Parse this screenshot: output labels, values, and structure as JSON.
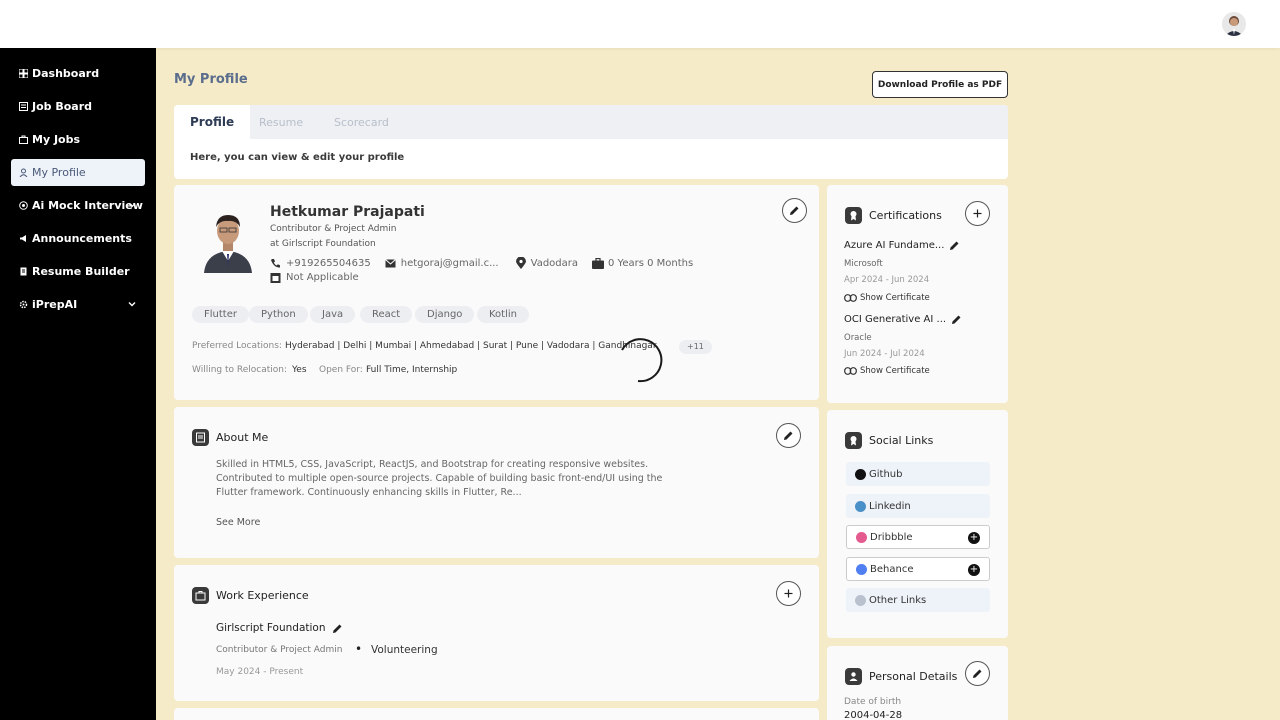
{
  "sidebar": {
    "items": [
      {
        "label": "Dashboard",
        "icon": "grid-icon"
      },
      {
        "label": "Job Board",
        "icon": "board-icon"
      },
      {
        "label": "My Jobs",
        "icon": "bag-icon"
      },
      {
        "label": "My Profile",
        "icon": "user-icon",
        "active": true
      },
      {
        "label": "Ai Mock Interview",
        "icon": "ai-icon",
        "expandable": true
      },
      {
        "label": "Announcements",
        "icon": "megaphone-icon"
      },
      {
        "label": "Resume Builder",
        "icon": "document-icon"
      },
      {
        "label": "iPrepAI",
        "icon": "gear-icon",
        "expandable": true
      }
    ]
  },
  "page": {
    "title": "My Profile",
    "download_pdf": "Download Profile as PDF"
  },
  "tabs": {
    "items": [
      "Profile",
      "Resume",
      "Scorecard"
    ],
    "active": "Profile",
    "description": "Here, you can view & edit your profile"
  },
  "profile": {
    "name": "Hetkumar Prajapati",
    "role": "Contributor & Project Admin",
    "organization": "at Girlscript Foundation",
    "phone": "+919265504635",
    "email": "hetgoraj@gmail.c...",
    "location": "Vadodara",
    "experience": "0 Years 0 Months",
    "notice": "Not Applicable",
    "skills": [
      "Flutter",
      "Python",
      "Java",
      "React",
      "Django",
      "Kotlin"
    ],
    "preferred_locations_label": "Preferred Locations:",
    "preferred_locations": "Hyderabad | Delhi | Mumbai | Ahmedabad | Surat | Pune | Vadodara | Gandhinagar",
    "more_locations": "+11",
    "relocation_label": "Willing to Relocation:",
    "relocation_value": "Yes",
    "open_for_label": "Open For:",
    "open_for_value": "Full Time, Internship"
  },
  "about": {
    "title": "About Me",
    "lines": [
      "Skilled in HTML5, CSS, JavaScript, ReactJS, and Bootstrap for creating responsive websites.",
      "Contributed to multiple open-source projects. Capable of building basic front-end/UI using the",
      "Flutter framework. Continuously enhancing skills in Flutter, Re..."
    ],
    "see_more": "See More"
  },
  "work": {
    "title": "Work Experience",
    "company": "Girlscript Foundation",
    "role": "Contributor & Project Admin",
    "type": "Volunteering",
    "duration": "May 2024 - Present"
  },
  "certifications": {
    "title": "Certifications",
    "items": [
      {
        "name": "Azure AI Fundame...",
        "issuer": "Microsoft",
        "dates": "Apr 2024 - Jun 2024",
        "link": "Show Certificate"
      },
      {
        "name": "OCI Generative AI ...",
        "issuer": "Oracle",
        "dates": "Jun 2024 - Jul 2024",
        "link": "Show Certificate"
      }
    ]
  },
  "social": {
    "title": "Social Links",
    "items": [
      {
        "label": "Github",
        "color": "#111111",
        "added": true
      },
      {
        "label": "Linkedin",
        "color": "#4a90c8",
        "added": true
      },
      {
        "label": "Dribbble",
        "color": "#e35b8f",
        "added": false
      },
      {
        "label": "Behance",
        "color": "#4f7ff0",
        "added": false
      },
      {
        "label": "Other Links",
        "color": "#b9c1cf",
        "added": true
      }
    ]
  },
  "personal": {
    "title": "Personal Details",
    "dob_label": "Date of birth",
    "dob": "2004-04-28"
  }
}
